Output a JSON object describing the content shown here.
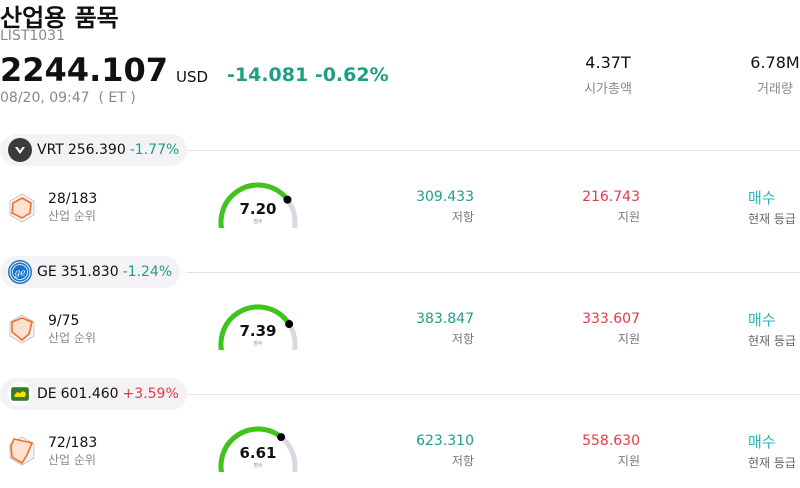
{
  "header": {
    "title": "산업용 품목",
    "code": "LIST1031",
    "price": "2244.107",
    "currency": "USD",
    "change": "-14.081 -0.62%",
    "timestamp": "08/20, 09:47  ( ET )"
  },
  "stats": [
    {
      "value": "4.37T",
      "label": "시가총액"
    },
    {
      "value": "6.78M",
      "label": "거래량"
    }
  ],
  "colors": {
    "negative": "#1f9e86",
    "positive": "#e5384a",
    "gauge_fill": "#3ec41b",
    "gauge_track": "#d9d9e3",
    "rating": "#2ab3c2",
    "radar": "#f0702b"
  },
  "rows": [
    {
      "ticker": "VRT",
      "price": "256.390",
      "change": "-1.77%",
      "direction": "neg",
      "logo": "vertiv-logo-icon",
      "rank": "28/183",
      "rank_label": "산업 순위",
      "score": "7.20",
      "score_label": "점수",
      "score_fraction": 0.72,
      "resistance": "309.433",
      "resistance_label": "저항",
      "support": "216.743",
      "support_label": "지원",
      "rating": "매수",
      "rating_label": "현재 등급"
    },
    {
      "ticker": "GE",
      "price": "351.830",
      "change": "-1.24%",
      "direction": "neg",
      "logo": "ge-logo-icon",
      "rank": "9/75",
      "rank_label": "산업 순위",
      "score": "7.39",
      "score_label": "점수",
      "score_fraction": 0.739,
      "resistance": "383.847",
      "resistance_label": "저항",
      "support": "333.607",
      "support_label": "지원",
      "rating": "매수",
      "rating_label": "현재 등급"
    },
    {
      "ticker": "DE",
      "price": "601.460",
      "change": "+3.59%",
      "direction": "pos",
      "logo": "john-deere-logo-icon",
      "rank": "72/183",
      "rank_label": "산업 순위",
      "score": "6.61",
      "score_label": "점수",
      "score_fraction": 0.661,
      "resistance": "623.310",
      "resistance_label": "저항",
      "support": "558.630",
      "support_label": "지원",
      "rating": "매수",
      "rating_label": "현재 등급"
    }
  ]
}
